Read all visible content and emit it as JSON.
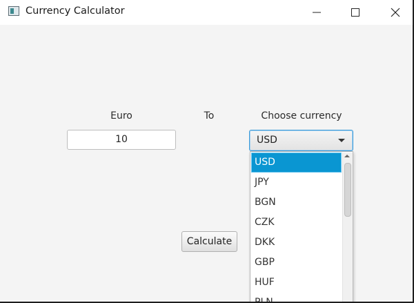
{
  "window": {
    "title": "Currency Calculator",
    "icon": "app-window-icon"
  },
  "titlebar_controls": {
    "minimize": "minimize-icon",
    "maximize": "maximize-icon",
    "close": "close-icon"
  },
  "form": {
    "from_label": "Euro",
    "to_label": "To",
    "choose_label": "Choose currency",
    "amount_value": "10",
    "selected_currency": "USD",
    "calculate_label": "Calculate"
  },
  "dropdown": {
    "options": [
      "USD",
      "JPY",
      "BGN",
      "CZK",
      "DKK",
      "GBP",
      "HUF",
      "PLN"
    ],
    "selected_index": 0
  },
  "colors": {
    "selection": "#0a96d2",
    "focus_border": "#3a9ad9"
  }
}
